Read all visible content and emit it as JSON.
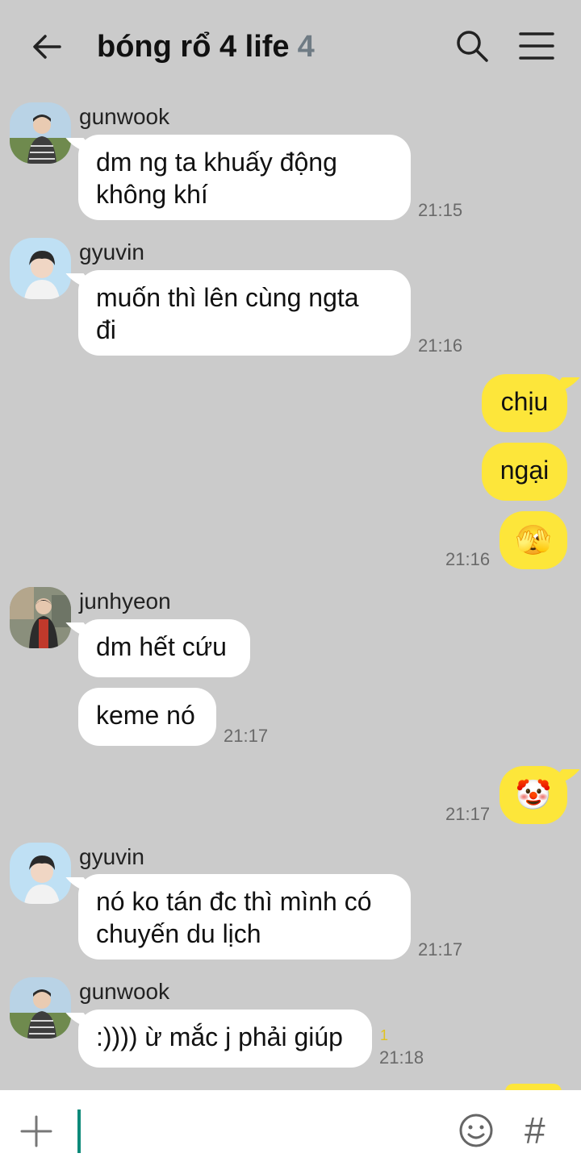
{
  "header": {
    "title": "bóng rổ 4 life",
    "member_count": "4"
  },
  "messages": {
    "m1": {
      "sender": "gunwook",
      "line1": "dm ng ta khuấy động",
      "line2": "không khí",
      "time": "21:15"
    },
    "m2": {
      "sender": "gyuvin",
      "line1": "muốn thì lên cùng ngta",
      "line2": "đi",
      "time": "21:16"
    },
    "m3": {
      "text1": "chịu",
      "text2": "ngại",
      "emoji": "🫣",
      "time": "21:16"
    },
    "m4": {
      "sender": "junhyeon",
      "text1": "dm hết cứu",
      "text2": "keme nó",
      "time": "21:17"
    },
    "m5": {
      "emoji": "🤡",
      "time": "21:17"
    },
    "m6": {
      "sender": "gyuvin",
      "line1": "nó ko tán đc thì mình có",
      "line2": "chuyến du lịch",
      "time": "21:17"
    },
    "m7": {
      "sender": "gunwook",
      "text": ":)))) ừ mắc j phải giúp",
      "unread": "1",
      "time": "21:18"
    }
  },
  "input": {
    "value": ""
  },
  "colors": {
    "background": "#cbcbcb",
    "outgoing_bubble": "#fde63a",
    "incoming_bubble": "#ffffff",
    "cursor": "#0e8a7a"
  }
}
